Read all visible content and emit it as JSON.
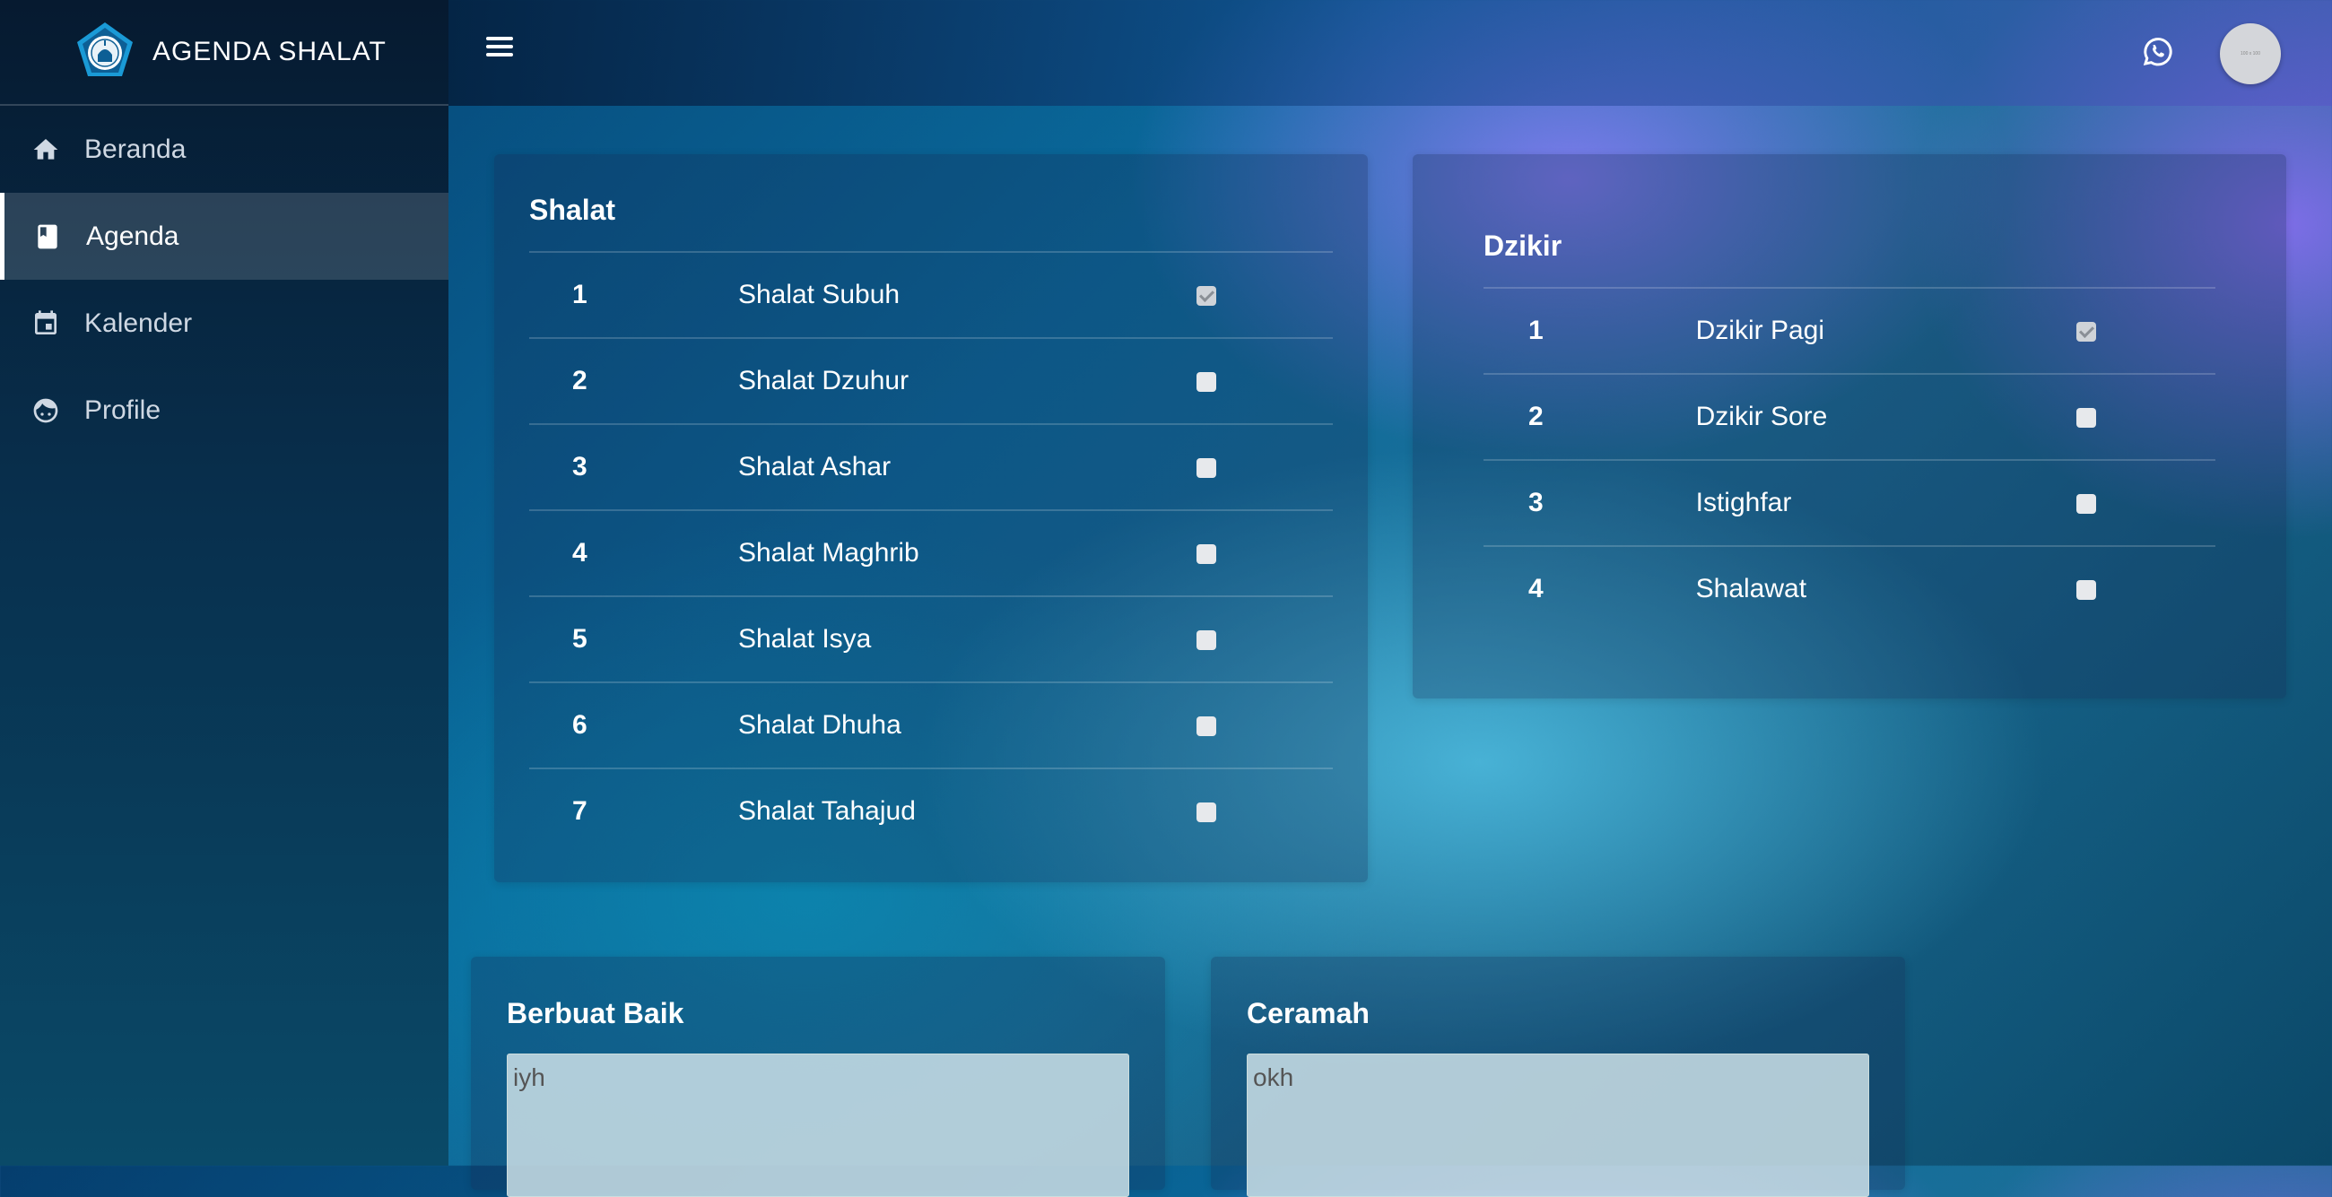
{
  "brand": {
    "title": "AGENDA SHALAT",
    "logo_icon": "mosque-emblem-icon"
  },
  "sidebar": {
    "items": [
      {
        "label": "Beranda",
        "icon": "home-icon"
      },
      {
        "label": "Agenda",
        "icon": "book-icon",
        "active": true
      },
      {
        "label": "Kalender",
        "icon": "calendar-icon"
      },
      {
        "label": "Profile",
        "icon": "face-icon"
      }
    ]
  },
  "header": {
    "menu_icon": "hamburger-icon",
    "whatsapp_icon": "whatsapp-icon",
    "avatar_text": "100 x 100"
  },
  "shalat": {
    "title": "Shalat",
    "rows": [
      {
        "no": "1",
        "name": "Shalat Subuh",
        "checked": true
      },
      {
        "no": "2",
        "name": "Shalat Dzuhur",
        "checked": false
      },
      {
        "no": "3",
        "name": "Shalat Ashar",
        "checked": false
      },
      {
        "no": "4",
        "name": "Shalat Maghrib",
        "checked": false
      },
      {
        "no": "5",
        "name": "Shalat Isya",
        "checked": false
      },
      {
        "no": "6",
        "name": "Shalat Dhuha",
        "checked": false
      },
      {
        "no": "7",
        "name": "Shalat Tahajud",
        "checked": false
      }
    ]
  },
  "dzikir": {
    "title": "Dzikir",
    "rows": [
      {
        "no": "1",
        "name": "Dzikir Pagi",
        "checked": true
      },
      {
        "no": "2",
        "name": "Dzikir Sore",
        "checked": false
      },
      {
        "no": "3",
        "name": "Istighfar",
        "checked": false
      },
      {
        "no": "4",
        "name": "Shalawat",
        "checked": false
      }
    ]
  },
  "berbuat_baik": {
    "title": "Berbuat Baik",
    "value": "iyh"
  },
  "ceramah": {
    "title": "Ceramah",
    "value": "okh"
  }
}
